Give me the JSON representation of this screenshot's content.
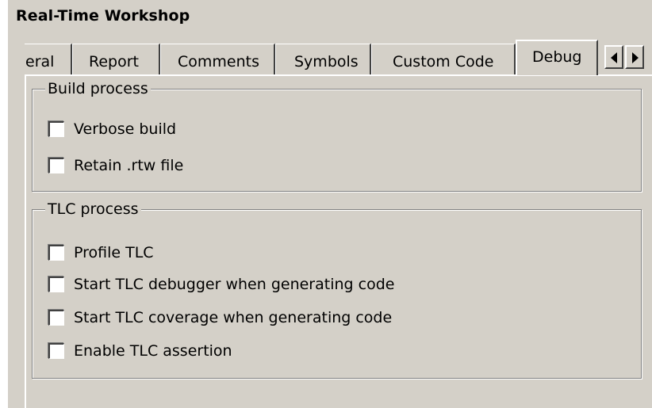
{
  "title": "Real-Time Workshop",
  "tabs": [
    {
      "label": "General",
      "visible_text": "eral",
      "selected": false
    },
    {
      "label": "Report",
      "selected": false
    },
    {
      "label": "Comments",
      "selected": false
    },
    {
      "label": "Symbols",
      "selected": false
    },
    {
      "label": "Custom Code",
      "selected": false
    },
    {
      "label": "Debug",
      "selected": true
    }
  ],
  "icons": {
    "scroll_left": "arrow-left-icon",
    "scroll_right": "arrow-right-icon"
  },
  "build_process": {
    "label": "Build process",
    "options": [
      {
        "label": "Verbose build",
        "checked": false
      },
      {
        "label": "Retain .rtw file",
        "checked": false
      }
    ]
  },
  "tlc_process": {
    "label": "TLC process",
    "options": [
      {
        "label": "Profile TLC",
        "checked": false
      },
      {
        "label": "Start TLC debugger when generating code",
        "checked": false
      },
      {
        "label": "Start TLC coverage when generating code",
        "checked": false
      },
      {
        "label": "Enable TLC assertion",
        "checked": false
      }
    ]
  },
  "colors": {
    "panel": "#d4d0c8",
    "highlight": "#ffffff",
    "shadow": "#808080",
    "dark_shadow": "#404040"
  }
}
